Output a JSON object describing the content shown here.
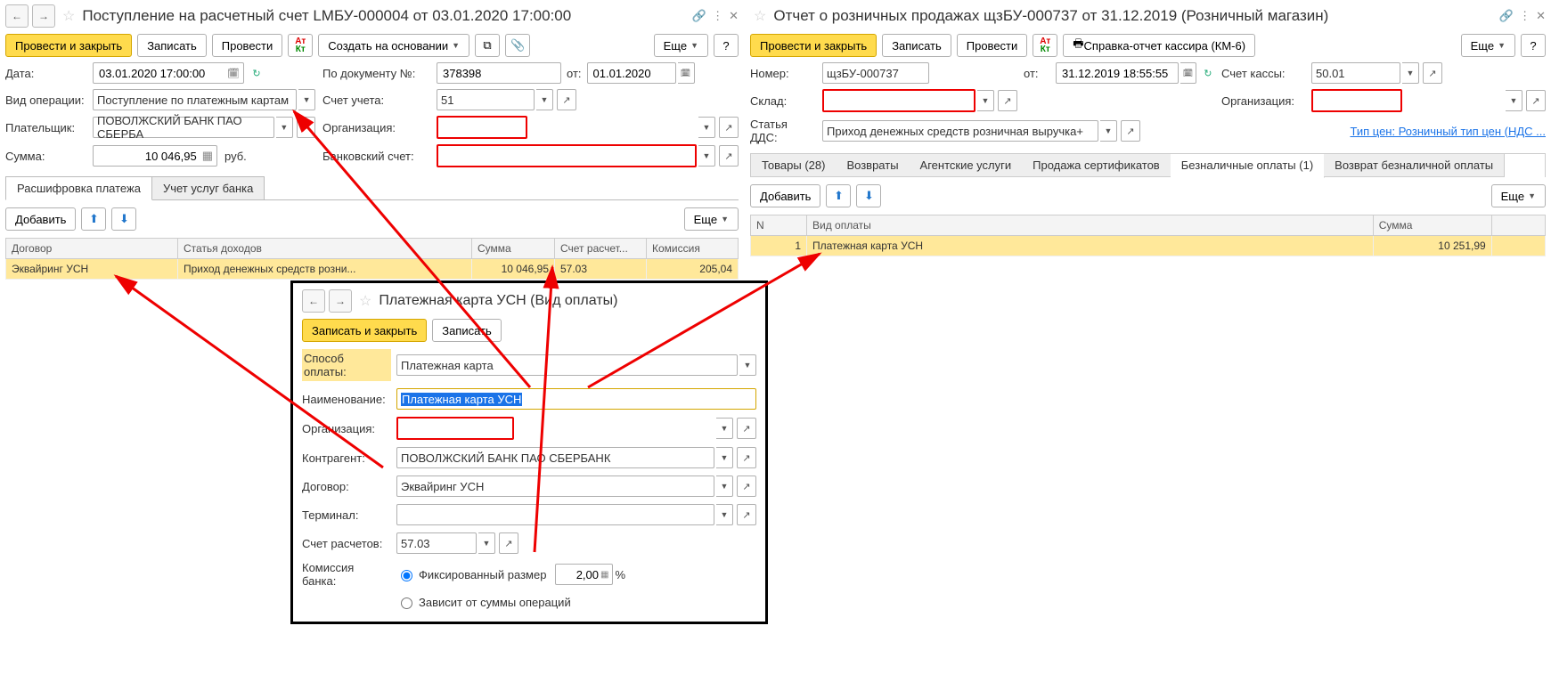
{
  "left": {
    "title": "Поступление на расчетный счет LMБУ-000004 от 03.01.2020 17:00:00",
    "toolbar": {
      "post_close": "Провести и закрыть",
      "write": "Записать",
      "post": "Провести",
      "create_based": "Создать на основании",
      "more": "Еще",
      "help": "?"
    },
    "fields": {
      "date_lbl": "Дата:",
      "date": "03.01.2020 17:00:00",
      "docnum_lbl": "По документу №:",
      "docnum": "378398",
      "from_lbl": "от:",
      "from": "01.01.2020",
      "optype_lbl": "Вид операции:",
      "optype": "Поступление по платежным картам",
      "account_lbl": "Счет учета:",
      "account": "51",
      "payer_lbl": "Плательщик:",
      "payer": "ПОВОЛЖСКИЙ БАНК ПАО СБЕРБА",
      "org_lbl": "Организация:",
      "sum_lbl": "Сумма:",
      "sum": "10 046,95",
      "rub": "руб.",
      "bankacc_lbl": "Банковский счет:"
    },
    "tabs": {
      "t1": "Расшифровка платежа",
      "t2": "Учет услуг банка"
    },
    "subbar": {
      "add": "Добавить",
      "more": "Еще"
    },
    "table": {
      "h1": "Договор",
      "h2": "Статья доходов",
      "h3": "Сумма",
      "h4": "Счет расчет...",
      "h5": "Комиссия",
      "r1c1": "Эквайринг УСН",
      "r1c2": "Приход денежных средств розни...",
      "r1c3": "10 046,95",
      "r1c4": "57.03",
      "r1c5": "205,04"
    }
  },
  "right": {
    "title": "Отчет о розничных продажах щзБУ-000737 от 31.12.2019 (Розничный магазин)",
    "toolbar": {
      "post_close": "Провести и закрыть",
      "write": "Записать",
      "post": "Провести",
      "report": "Справка-отчет кассира (КМ-6)",
      "more": "Еще",
      "help": "?"
    },
    "fields": {
      "num_lbl": "Номер:",
      "num": "щзБУ-000737",
      "from_lbl": "от:",
      "from": "31.12.2019 18:55:55",
      "cashacc_lbl": "Счет кассы:",
      "cashacc": "50.01",
      "warehouse_lbl": "Склад:",
      "org_lbl": "Организация:",
      "dds_lbl": "Статья ДДС:",
      "dds": "Приход денежных средств розничная выручка+",
      "pricetype_link": "Тип цен: Розничный тип цен (НДС ..."
    },
    "tabs": {
      "t1": "Товары (28)",
      "t2": "Возвраты",
      "t3": "Агентские услуги",
      "t4": "Продажа сертификатов",
      "t5": "Безналичные оплаты (1)",
      "t6": "Возврат безналичной оплаты"
    },
    "subbar": {
      "add": "Добавить",
      "more": "Еще"
    },
    "table": {
      "h1": "N",
      "h2": "Вид оплаты",
      "h3": "Сумма",
      "r1c1": "1",
      "r1c2": "Платежная карта УСН",
      "r1c3": "10 251,99"
    }
  },
  "popup": {
    "title": "Платежная карта УСН (Вид оплаты)",
    "write_close": "Записать и закрыть",
    "write": "Записать",
    "method_lbl": "Способ оплаты:",
    "method": "Платежная карта",
    "name_lbl": "Наименование:",
    "name": "Платежная карта УСН",
    "org_lbl": "Организация:",
    "counterparty_lbl": "Контрагент:",
    "counterparty": "ПОВОЛЖСКИЙ БАНК ПАО СБЕРБАНК",
    "contract_lbl": "Договор:",
    "contract": "Эквайринг УСН",
    "terminal_lbl": "Терминал:",
    "settle_lbl": "Счет расчетов:",
    "settle": "57.03",
    "commission_lbl": "Комиссия банка:",
    "fixed": "Фиксированный размер",
    "percent_val": "2,00",
    "percent": "%",
    "depends": "Зависит от суммы операций"
  }
}
